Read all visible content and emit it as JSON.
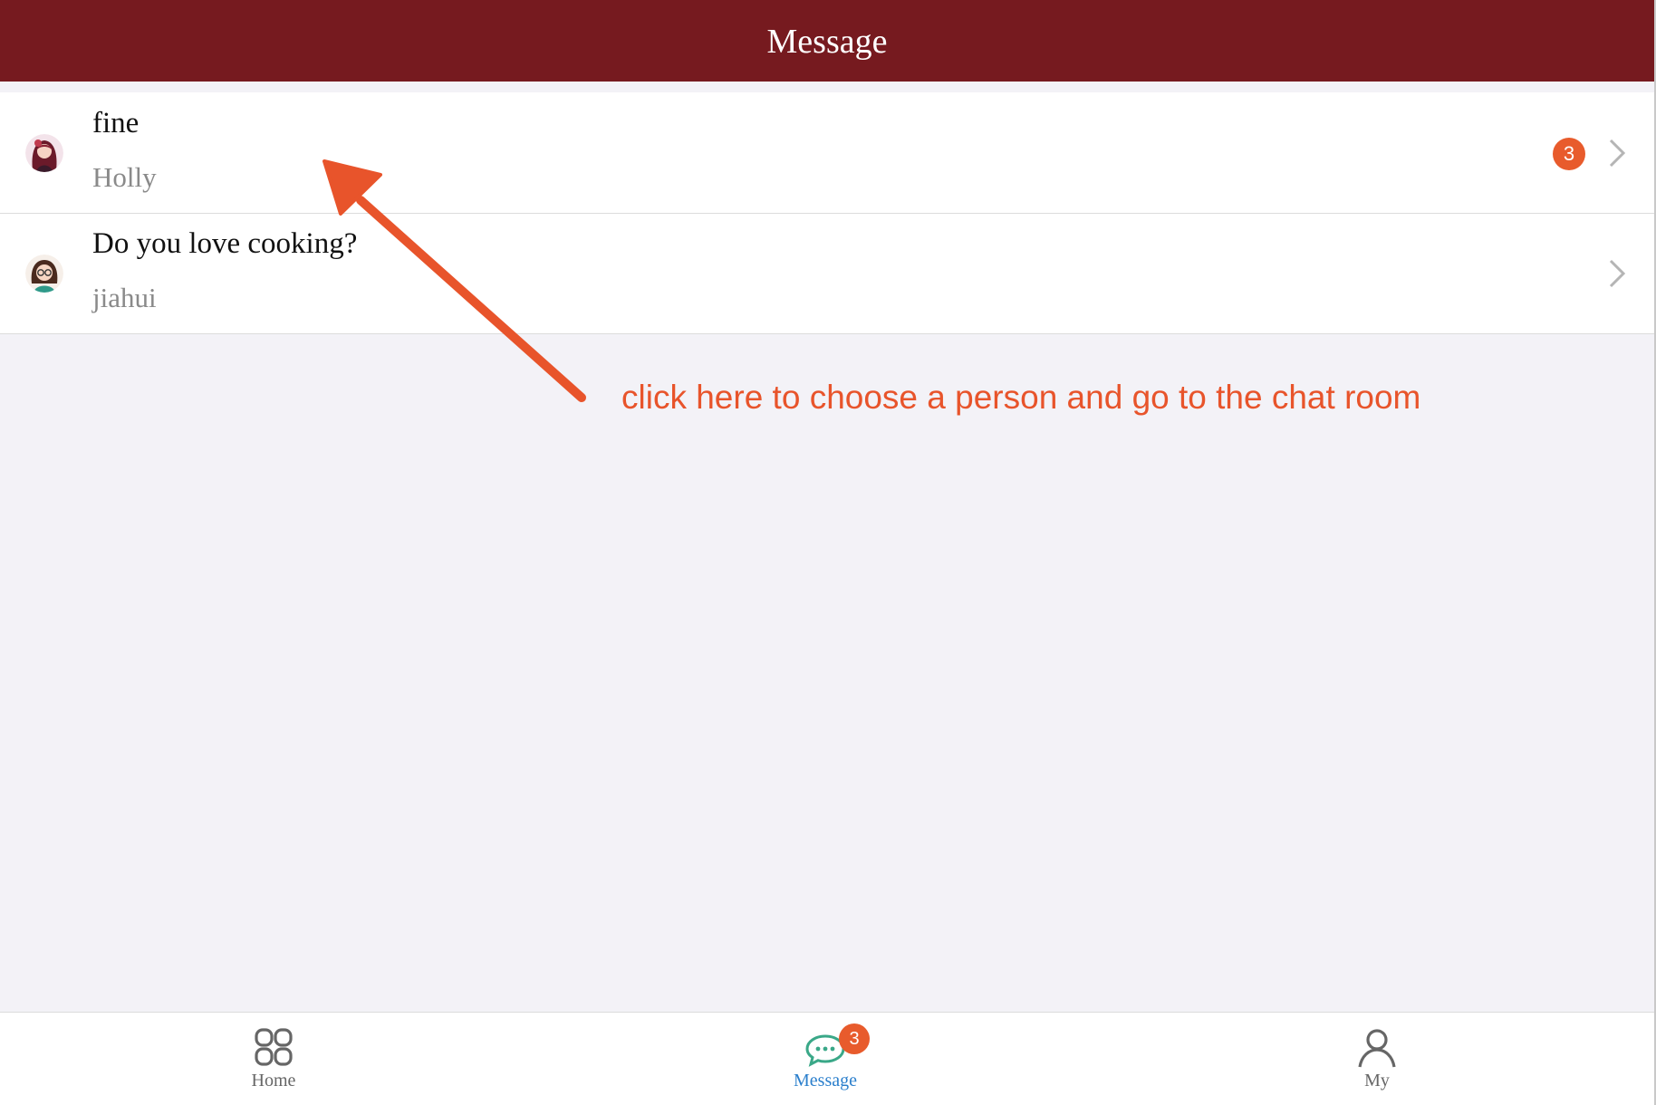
{
  "header": {
    "title": "Message"
  },
  "conversations": [
    {
      "message": "fine",
      "sender": "Holly",
      "unread": "3",
      "avatar_icon": "woman-avatar-icon"
    },
    {
      "message": "Do you love cooking?",
      "sender": "jiahui",
      "unread": "",
      "avatar_icon": "girl-with-glasses-avatar-icon"
    }
  ],
  "annotation": {
    "text": "click here to choose a person and go to the chat room",
    "color": "#e8542b"
  },
  "tabbar": {
    "tabs": [
      {
        "label": "Home",
        "icon": "grid-icon",
        "active": false
      },
      {
        "label": "Message",
        "icon": "chat-bubble-icon",
        "active": true,
        "badge": "3"
      },
      {
        "label": "My",
        "icon": "person-icon",
        "active": false
      }
    ]
  },
  "colors": {
    "header_bg": "#761a1f",
    "badge": "#e85b2c",
    "active_tab": "#2b7fcc",
    "background": "#f3f2f7"
  }
}
